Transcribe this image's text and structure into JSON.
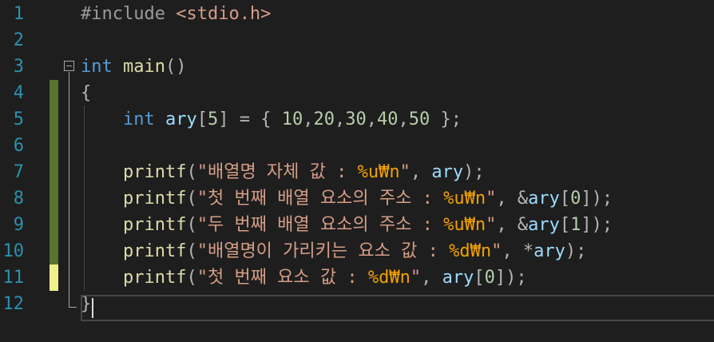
{
  "editor": {
    "line_numbers": [
      "1",
      "2",
      "3",
      "4",
      "5",
      "6",
      "7",
      "8",
      "9",
      "10",
      "11",
      "12"
    ],
    "lines": [
      [
        {
          "t": "#include ",
          "c": "c-pre"
        },
        {
          "t": "<stdio.h>",
          "c": "c-inc"
        }
      ],
      [],
      [
        {
          "t": "int",
          "c": "c-kw"
        },
        {
          "t": " ",
          "c": ""
        },
        {
          "t": "main",
          "c": "c-fn"
        },
        {
          "t": "()",
          "c": "c-pun"
        }
      ],
      [
        {
          "t": "{",
          "c": "c-pun"
        }
      ],
      [
        {
          "t": "    ",
          "c": ""
        },
        {
          "t": "int",
          "c": "c-kw"
        },
        {
          "t": " ",
          "c": ""
        },
        {
          "t": "ary",
          "c": "c-var"
        },
        {
          "t": "[",
          "c": "c-pun"
        },
        {
          "t": "5",
          "c": "c-num"
        },
        {
          "t": "] = { ",
          "c": "c-pun"
        },
        {
          "t": "10",
          "c": "c-num"
        },
        {
          "t": ",",
          "c": "c-pun"
        },
        {
          "t": "20",
          "c": "c-num"
        },
        {
          "t": ",",
          "c": "c-pun"
        },
        {
          "t": "30",
          "c": "c-num"
        },
        {
          "t": ",",
          "c": "c-pun"
        },
        {
          "t": "40",
          "c": "c-num"
        },
        {
          "t": ",",
          "c": "c-pun"
        },
        {
          "t": "50",
          "c": "c-num"
        },
        {
          "t": " };",
          "c": "c-pun"
        }
      ],
      [],
      [
        {
          "t": "    ",
          "c": ""
        },
        {
          "t": "printf",
          "c": "c-fn"
        },
        {
          "t": "(",
          "c": "c-pun"
        },
        {
          "t": "\"배열명 자체 값 : ",
          "c": "c-str"
        },
        {
          "t": "%u",
          "c": "c-fmt"
        },
        {
          "t": "₩n",
          "c": "c-fmt"
        },
        {
          "t": "\"",
          "c": "c-str"
        },
        {
          "t": ", ",
          "c": "c-pun"
        },
        {
          "t": "ary",
          "c": "c-var"
        },
        {
          "t": ");",
          "c": "c-pun"
        }
      ],
      [
        {
          "t": "    ",
          "c": ""
        },
        {
          "t": "printf",
          "c": "c-fn"
        },
        {
          "t": "(",
          "c": "c-pun"
        },
        {
          "t": "\"첫 번째 배열 요소의 주소 : ",
          "c": "c-str"
        },
        {
          "t": "%u",
          "c": "c-fmt"
        },
        {
          "t": "₩n",
          "c": "c-fmt"
        },
        {
          "t": "\"",
          "c": "c-str"
        },
        {
          "t": ", &",
          "c": "c-pun"
        },
        {
          "t": "ary",
          "c": "c-var"
        },
        {
          "t": "[",
          "c": "c-pun"
        },
        {
          "t": "0",
          "c": "c-num"
        },
        {
          "t": "]);",
          "c": "c-pun"
        }
      ],
      [
        {
          "t": "    ",
          "c": ""
        },
        {
          "t": "printf",
          "c": "c-fn"
        },
        {
          "t": "(",
          "c": "c-pun"
        },
        {
          "t": "\"두 번째 배열 요소의 주소 : ",
          "c": "c-str"
        },
        {
          "t": "%u",
          "c": "c-fmt"
        },
        {
          "t": "₩n",
          "c": "c-fmt"
        },
        {
          "t": "\"",
          "c": "c-str"
        },
        {
          "t": ", &",
          "c": "c-pun"
        },
        {
          "t": "ary",
          "c": "c-var"
        },
        {
          "t": "[",
          "c": "c-pun"
        },
        {
          "t": "1",
          "c": "c-num"
        },
        {
          "t": "]);",
          "c": "c-pun"
        }
      ],
      [
        {
          "t": "    ",
          "c": ""
        },
        {
          "t": "printf",
          "c": "c-fn"
        },
        {
          "t": "(",
          "c": "c-pun"
        },
        {
          "t": "\"배열명이 가리키는 요소 값 : ",
          "c": "c-str"
        },
        {
          "t": "%d",
          "c": "c-fmt"
        },
        {
          "t": "₩n",
          "c": "c-fmt"
        },
        {
          "t": "\"",
          "c": "c-str"
        },
        {
          "t": ", *",
          "c": "c-pun"
        },
        {
          "t": "ary",
          "c": "c-var"
        },
        {
          "t": ");",
          "c": "c-pun"
        }
      ],
      [
        {
          "t": "    ",
          "c": ""
        },
        {
          "t": "printf",
          "c": "c-fn"
        },
        {
          "t": "(",
          "c": "c-pun"
        },
        {
          "t": "\"첫 번째 요소 값 : ",
          "c": "c-str"
        },
        {
          "t": "%d",
          "c": "c-fmt"
        },
        {
          "t": "₩n",
          "c": "c-fmt"
        },
        {
          "t": "\"",
          "c": "c-str"
        },
        {
          "t": ", ",
          "c": "c-pun"
        },
        {
          "t": "ary",
          "c": "c-var"
        },
        {
          "t": "[",
          "c": "c-pun"
        },
        {
          "t": "0",
          "c": "c-num"
        },
        {
          "t": "]);",
          "c": "c-pun"
        }
      ],
      [
        {
          "t": "}",
          "c": "c-pun"
        }
      ]
    ],
    "change_markers": [
      "none",
      "none",
      "none",
      "saved",
      "saved",
      "saved",
      "saved",
      "saved",
      "saved",
      "saved",
      "unsaved",
      "none"
    ],
    "colors": {
      "background": "#1e1e1e",
      "line_number": "#2b91af",
      "keyword": "#569cd6",
      "function": "#dcdcaa",
      "variable": "#9cdcfe",
      "number": "#b5cea8",
      "string": "#d69d85",
      "format_specifier": "#f0a000",
      "saved_change_marker": "#577430",
      "unsaved_change_marker": "#efef8e"
    },
    "fold_icon": "collapse-minus-icon"
  }
}
